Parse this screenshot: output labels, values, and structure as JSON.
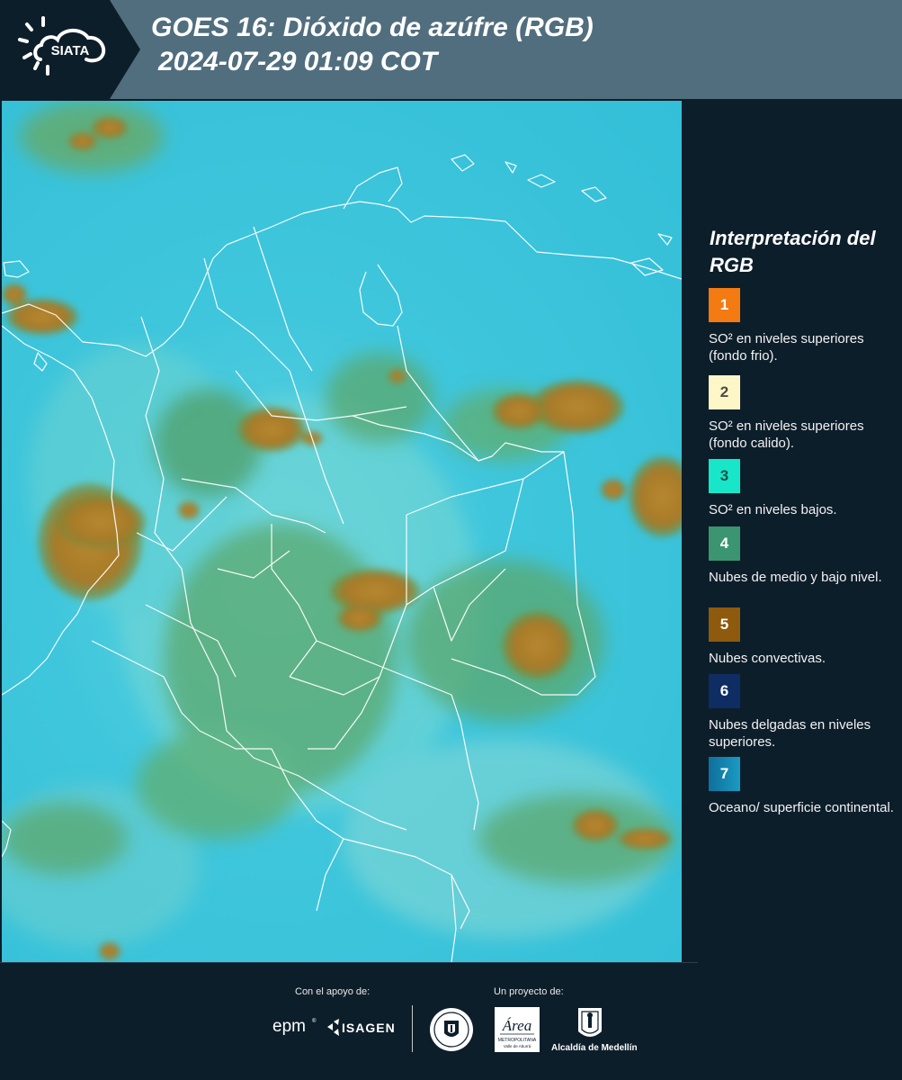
{
  "header": {
    "logo_text": "SIATA",
    "title_line1": "GOES 16: Dióxido de azúfre (RGB)",
    "title_line2": "2024-07-29 01:09 COT"
  },
  "legend": {
    "title": "Interpretación del RGB",
    "items": [
      {
        "number": "1",
        "color": "#f47a12",
        "text": "SO² en niveles superiores (fondo frio)."
      },
      {
        "number": "2",
        "color": "#fdf6c6",
        "text": "SO² en niveles superiores (fondo calido)."
      },
      {
        "number": "3",
        "color": "#17e6c9",
        "text": "SO² en niveles bajos."
      },
      {
        "number": "4",
        "color": "#3a9570",
        "text": "Nubes de medio y bajo nivel."
      },
      {
        "number": "5",
        "color": "#8e5a0d",
        "text": "Nubes convectivas."
      },
      {
        "number": "6",
        "color": "#0e2d63",
        "text": "Nubes delgadas en niveles superiores."
      },
      {
        "number": "7",
        "color": "#1588b0",
        "text": "Oceano/ superficie continental."
      }
    ]
  },
  "footer": {
    "support_label": "Con el apoyo de:",
    "project_label": "Un proyecto de:",
    "epm_text": "epm",
    "isagen_text": "ISAGEN",
    "metropolitana_text": "Área",
    "metropolitana_sub": "METROPOLITANA",
    "metropolitana_sub2": "Valle de Aburrá",
    "alcaldia_text": "Alcaldía de Medellín"
  },
  "colors": {
    "header_bg": "#516e7e",
    "page_bg": "#0d1e2b",
    "map_cyan": "#3fc6dc",
    "convective_brown": "#a67a2a",
    "mid_cloud_green": "#3a9a6a"
  }
}
